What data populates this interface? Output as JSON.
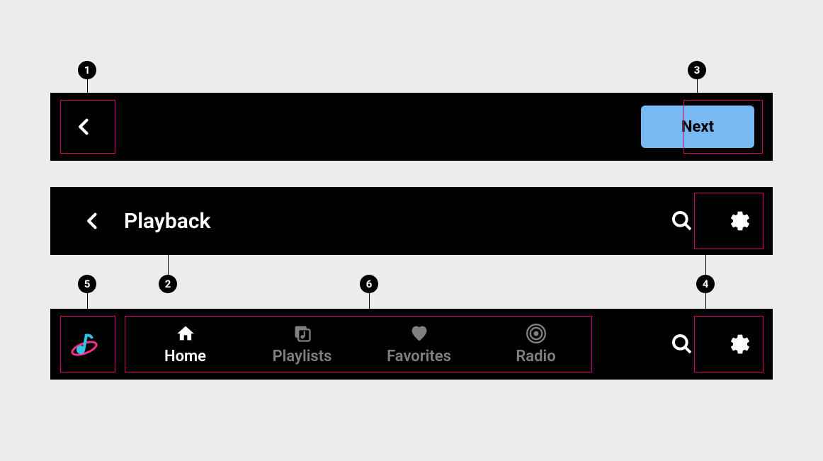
{
  "bar1": {
    "next_label": "Next"
  },
  "bar2": {
    "title": "Playback"
  },
  "bar3": {
    "tabs": [
      {
        "label": "Home"
      },
      {
        "label": "Playlists"
      },
      {
        "label": "Favorites"
      },
      {
        "label": "Radio"
      }
    ]
  },
  "callouts": {
    "c1": "1",
    "c2": "2",
    "c3": "3",
    "c4": "4",
    "c5": "5",
    "c6": "6"
  }
}
